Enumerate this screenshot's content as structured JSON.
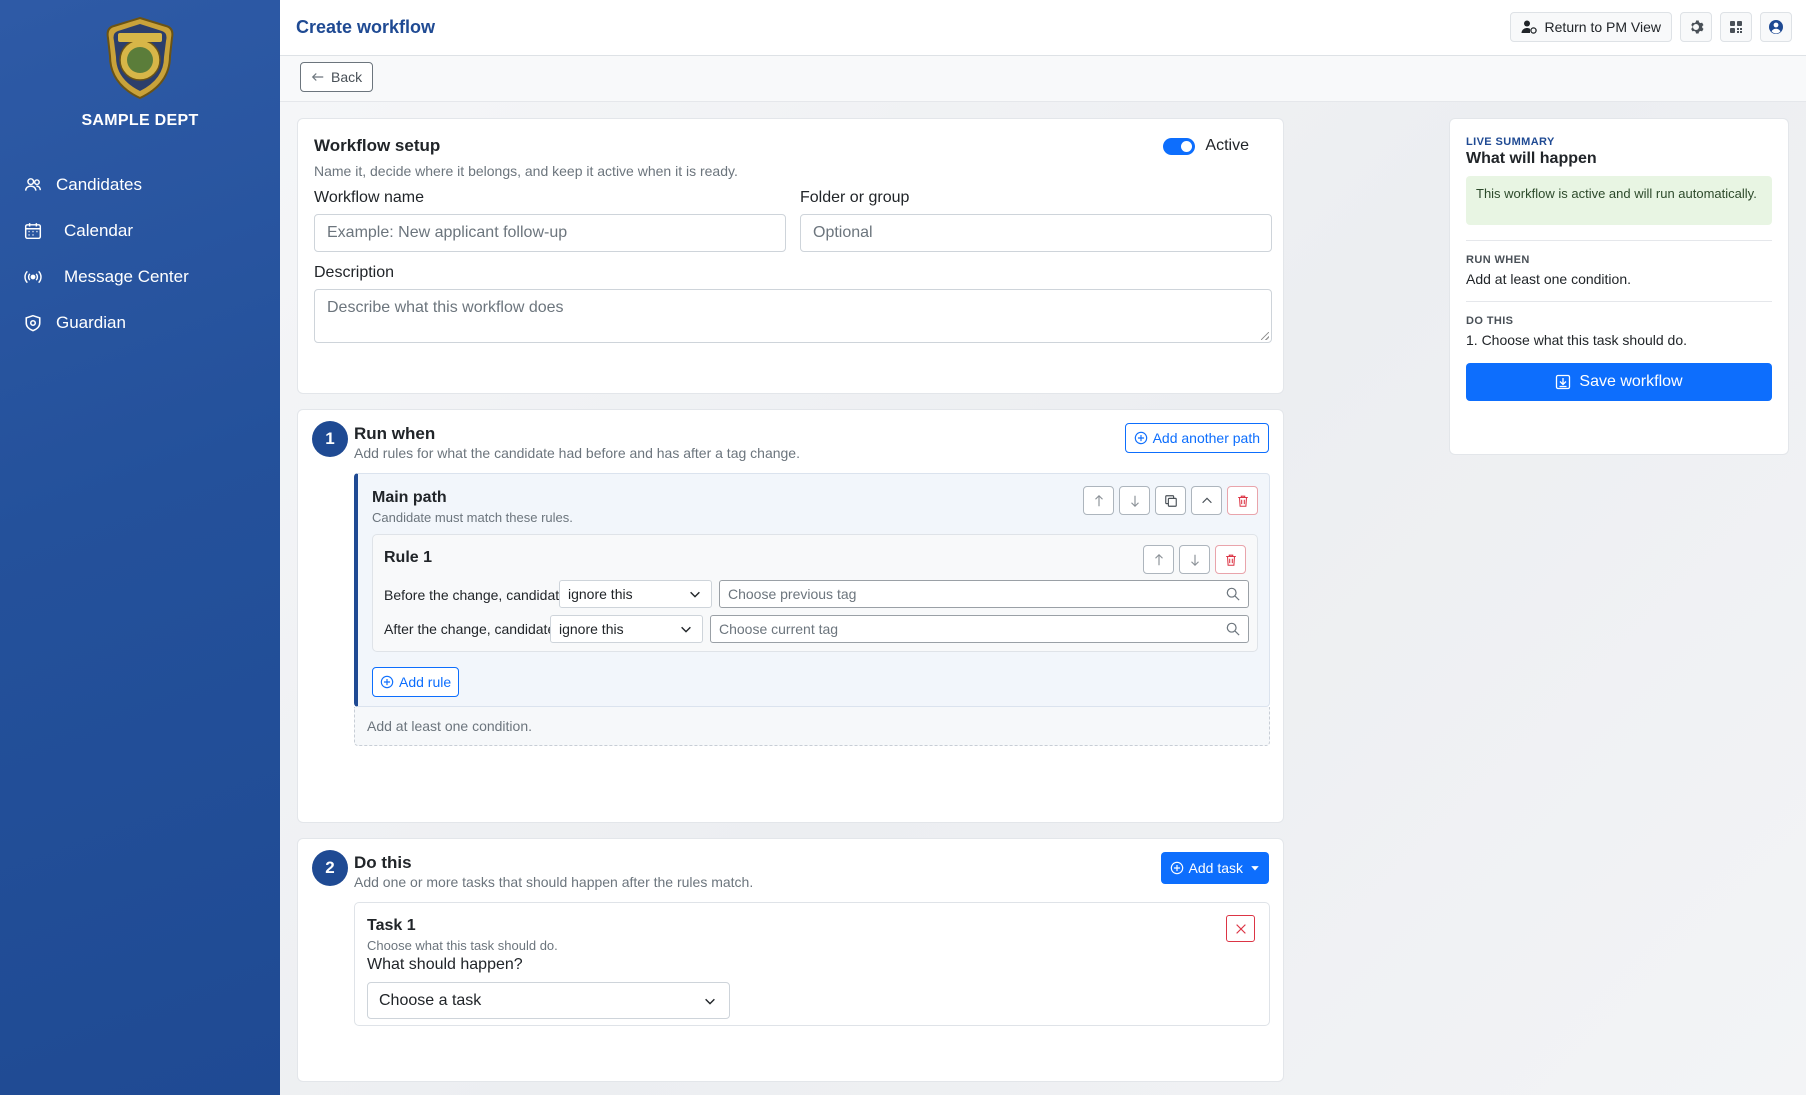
{
  "sidebar": {
    "dept_name": "SAMPLE DEPT",
    "logo_icon": "police-badge-icon",
    "items": [
      {
        "label": "Candidates",
        "icon": "people-icon"
      },
      {
        "label": "Calendar",
        "icon": "calendar-icon"
      },
      {
        "label": "Message Center",
        "icon": "broadcast-icon"
      },
      {
        "label": "Guardian",
        "icon": "shield-icon"
      }
    ]
  },
  "topbar": {
    "title": "Create workflow",
    "return_label": "Return to PM View"
  },
  "backbar": {
    "back_label": "Back"
  },
  "setup": {
    "title": "Workflow setup",
    "subtitle": "Name it, decide where it belongs, and keep it active when it is ready.",
    "active_label": "Active",
    "active": true,
    "name_label": "Workflow name",
    "name_placeholder": "Example: New applicant follow-up",
    "folder_label": "Folder or group",
    "folder_placeholder": "Optional",
    "description_label": "Description",
    "description_placeholder": "Describe what this workflow does"
  },
  "run_when": {
    "step": "1",
    "title": "Run when",
    "subtitle": "Add rules for what the candidate had before and has after a tag change.",
    "add_path_label": "Add another path",
    "path": {
      "title": "Main path",
      "subtitle": "Candidate must match these rules.",
      "rule": {
        "title": "Rule 1",
        "before_label": "Before the change, candidate",
        "before_value": "ignore this",
        "before_tag_placeholder": "Choose previous tag",
        "after_label": "After the change, candidate",
        "after_value": "ignore this",
        "after_tag_placeholder": "Choose current tag"
      },
      "add_rule_label": "Add rule"
    },
    "condition_note": "Add at least one condition."
  },
  "do_this": {
    "step": "2",
    "title": "Do this",
    "subtitle": "Add one or more tasks that should happen after the rules match.",
    "add_task_label": "Add task",
    "task": {
      "title": "Task 1",
      "subtitle": "Choose what this task should do.",
      "question": "What should happen?",
      "select_value": "Choose a task"
    }
  },
  "summary": {
    "eyebrow": "LIVE SUMMARY",
    "title": "What will happen",
    "alert": "This workflow is active and will run automatically.",
    "run_when_label": "RUN WHEN",
    "run_when_text": "Add at least one condition.",
    "do_this_label": "DO THIS",
    "do_this_text": "1. Choose what this task should do.",
    "save_label": "Save workflow"
  },
  "colors": {
    "sidebar": "#24519b",
    "primary": "#0d6efd",
    "brand_dark": "#1f4a93",
    "danger": "#dc3545",
    "success_bg": "#e8f5e3"
  }
}
